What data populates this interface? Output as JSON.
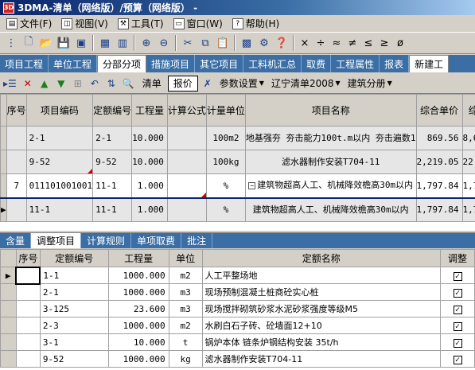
{
  "window": {
    "title": "3DMA-清单（网络版）/预算（网络版） -"
  },
  "menu": [
    {
      "label": "文件(F)",
      "icon": "file-menu-icon"
    },
    {
      "label": "视图(V)",
      "icon": "view-menu-icon"
    },
    {
      "label": "工具(T)",
      "icon": "tools-menu-icon"
    },
    {
      "label": "窗口(W)",
      "icon": "window-menu-icon"
    },
    {
      "label": "帮助(H)",
      "icon": "help-menu-icon"
    }
  ],
  "toolbar_ops": [
    "×",
    "÷",
    "≈",
    "≠",
    "≤",
    "≥",
    "ø"
  ],
  "tabs": [
    "项目工程",
    "单位工程",
    "分部分项",
    "措施项目",
    "其它项目",
    "工料机汇总",
    "取费",
    "工程属性",
    "报表",
    "新建工"
  ],
  "active_tab": "分部分项",
  "subtoolbar": {
    "list_label": "清单",
    "price_label": "报价",
    "params_label": "参数设置",
    "region_select": "辽宁清单2008",
    "division_select": "建筑分册"
  },
  "grid1": {
    "headers": [
      "序号",
      "项目编码",
      "定额编号",
      "工程量",
      "计算公式",
      "计量单位",
      "项目名称",
      "综合单价",
      "综"
    ],
    "rows": [
      {
        "seq": "",
        "code": "2-1",
        "quota": "2-1",
        "qty": "10.000",
        "formula": "",
        "unit": "100m2",
        "name": "地基强夯 夯击能力100t.m以内 夯击遍数1",
        "price": "869.56",
        "extra": "8,6"
      },
      {
        "seq": "",
        "code": "9-52",
        "quota": "9-52",
        "qty": "10.000",
        "formula": "",
        "unit": "100kg",
        "name": "滤水器制作安装T704-11",
        "price": "2,219.05",
        "extra": "22,1"
      },
      {
        "seq": "7",
        "code": "011101001001",
        "quota": "11-1",
        "qty": "1.000",
        "formula": "",
        "unit": "%",
        "name": "建筑物超高人工、机械降效檐高30m以内",
        "price": "1,797.84",
        "extra": "1,7"
      },
      {
        "seq": "",
        "code": "11-1",
        "quota": "11-1",
        "qty": "1.000",
        "formula": "",
        "unit": "%",
        "name": "建筑物超高人工、机械降效檐高30m以内",
        "price": "1,797.84",
        "extra": "1,7"
      }
    ]
  },
  "lowtabs": [
    "含量",
    "调整项目",
    "计算规则",
    "单项取费",
    "批注"
  ],
  "active_lowtab": "调整项目",
  "grid2": {
    "headers": [
      "序号",
      "定额编号",
      "工程量",
      "单位",
      "定额名称",
      "调整"
    ],
    "rows": [
      {
        "seq": "",
        "quota": "1-1",
        "qty": "1000.000",
        "unit": "m2",
        "name": "人工平整场地",
        "adjust": "✓"
      },
      {
        "seq": "",
        "quota": "2-1",
        "qty": "1000.000",
        "unit": "m3",
        "name": "现场预制混凝土桩商砼实心桩",
        "adjust": "✓"
      },
      {
        "seq": "",
        "quota": "3-125",
        "qty": "23.600",
        "unit": "m3",
        "name": "现场搅拌砌筑砂浆水泥砂浆强度等级M5",
        "adjust": "✓"
      },
      {
        "seq": "",
        "quota": "2-3",
        "qty": "1000.000",
        "unit": "m2",
        "name": "水刷白石子砖、砼墙面12+10",
        "adjust": "✓"
      },
      {
        "seq": "",
        "quota": "3-1",
        "qty": "10.000",
        "unit": "t",
        "name": "锅炉本体 链条炉钢结构安装 35t/h",
        "adjust": "✓"
      },
      {
        "seq": "",
        "quota": "9-52",
        "qty": "1000.000",
        "unit": "kg",
        "name": "滤水器制作安装T704-11",
        "adjust": "✓"
      }
    ]
  }
}
